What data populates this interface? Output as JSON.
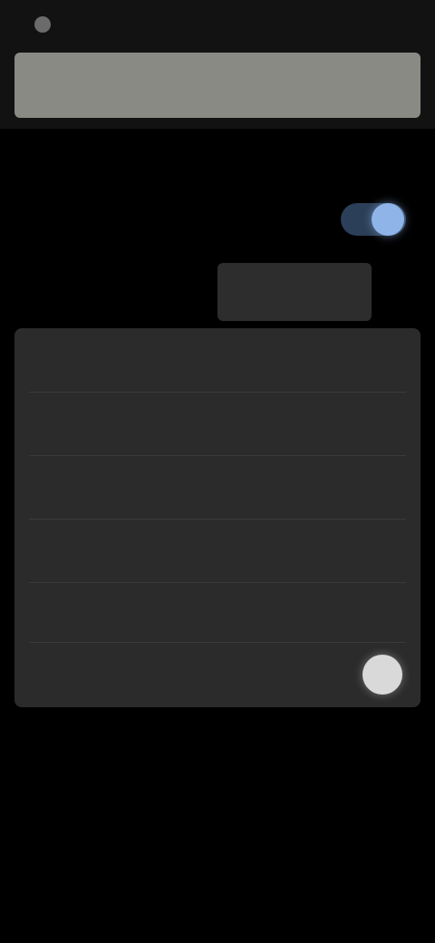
{
  "status_bar": {
    "time": ""
  },
  "search": {
    "value": ""
  },
  "section": {
    "title": ""
  },
  "main_toggle": {
    "label": "",
    "state": "on",
    "knob_color": "#8fb4e8"
  },
  "segmented": {
    "options": [
      "",
      ""
    ],
    "selected_index": 1
  },
  "list": {
    "items": [
      {
        "label": "",
        "value": ""
      },
      {
        "label": "",
        "value": ""
      },
      {
        "label": "",
        "value": ""
      },
      {
        "label": "",
        "value": ""
      },
      {
        "label": "",
        "value": ""
      }
    ],
    "bottom_toggle": {
      "label": "",
      "state": "off"
    }
  },
  "colors": {
    "background": "#000000",
    "card": "#2b2b2b",
    "search_bar": "#8a8a85",
    "accent": "#8fb4e8"
  }
}
